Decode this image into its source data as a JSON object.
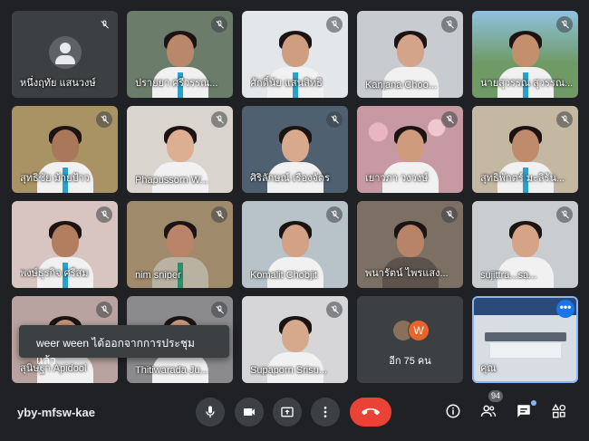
{
  "tiles": [
    {
      "name": "หนึ่งฤทัย แสนวงษ์",
      "bg": "#3c4043",
      "type": "avatar"
    },
    {
      "name": "ปรายยา ศรีวรรณ...",
      "bg": "#6b7c6a",
      "skin": "#b9876a",
      "type": "person"
    },
    {
      "name": "ศักดิ์นัย แสนสิทธิ",
      "bg": "#e4e7ea",
      "skin": "#cf9d7f",
      "type": "person"
    },
    {
      "name": "Kanjana Choo...",
      "bg": "#c8cbd0",
      "skin": "#d3a48a",
      "type": "person"
    },
    {
      "name": "นายสุวรรณ สุวรรณ...",
      "bg": "#6f9a66",
      "skin": "#c38f6c",
      "type": "person"
    },
    {
      "name": "สุทธิชัย ม้ายป้าว",
      "bg": "#a99263",
      "skin": "#a9775a",
      "type": "person"
    },
    {
      "name": "Phapussorn W...",
      "bg": "#d9d4cd",
      "skin": "#dcae92",
      "type": "person"
    },
    {
      "name": "ศิริลักษณ์ เรืองจัตร",
      "bg": "#4f6170",
      "skin": "#d8a98c",
      "type": "person"
    },
    {
      "name": "เยาวภา วงวงษ์",
      "bg": "#c79aa3",
      "skin": "#cf9b7d",
      "type": "person"
    },
    {
      "name": "สุทธิพักตร์ มะลิรัน...",
      "bg": "#c4b8a3",
      "skin": "#bd8a6c",
      "type": "person"
    },
    {
      "name": "พงษ์ธุรกิจ ศรีสม",
      "bg": "#d8c4c0",
      "skin": "#b37d60",
      "type": "person"
    },
    {
      "name": "nim sniper",
      "bg": "#a08a6c",
      "skin": "#b98468",
      "type": "person"
    },
    {
      "name": "Komalit Chobjit",
      "bg": "#b7c3c9",
      "skin": "#d3a185",
      "type": "person"
    },
    {
      "name": "พนารัตน์ ไพรแสง...",
      "bg": "#7c7065",
      "skin": "#b7846a",
      "type": "person"
    },
    {
      "name": "sujittra...sa...",
      "bg": "#c9cdd0",
      "skin": "#d5a487",
      "type": "person"
    },
    {
      "name": "สุนิษฐา Apidool",
      "bg": "#b9a3a0",
      "skin": "#c6957b",
      "type": "person"
    },
    {
      "name": "Thitiwarada Ju...",
      "bg": "#8b8a8c",
      "skin": "#cb9c80",
      "type": "person"
    },
    {
      "name": "Supaporn Srisu...",
      "bg": "#d6d6d8",
      "skin": "#d6a88c",
      "type": "person"
    },
    {
      "name": "",
      "bg": "#3c4043",
      "type": "more",
      "more_label": "อีก 75 คน",
      "avatar_letter": "W"
    },
    {
      "name": "คุณ",
      "bg": "#d7dde3",
      "type": "presentation"
    }
  ],
  "toast": {
    "text": "weer ween ได้ออกจากการประชุมแล้ว"
  },
  "meeting": {
    "code": "yby-mfsw-kae",
    "participant_count": "94"
  },
  "colors": {
    "end_call": "#ea4335",
    "accent": "#8ab4f8",
    "tile_bg": "#3c4043",
    "bar_bg": "#202124"
  }
}
